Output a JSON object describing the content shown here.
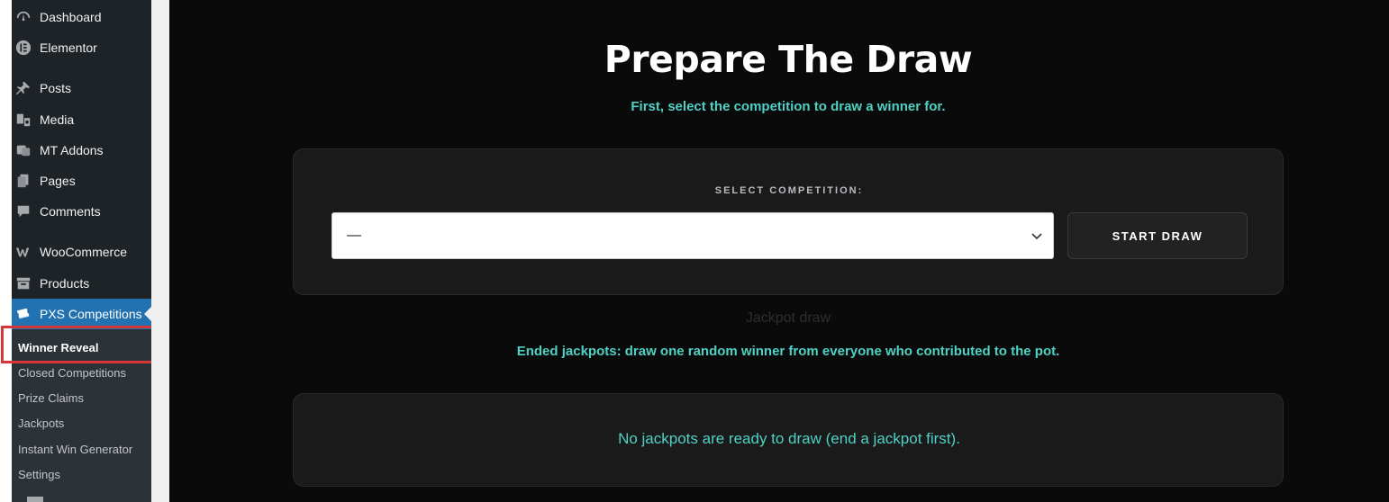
{
  "sidebar": {
    "items": [
      {
        "label": "Dashboard",
        "icon": "dashboard-icon"
      },
      {
        "label": "Elementor",
        "icon": "elementor-icon"
      },
      {
        "label": "Posts",
        "icon": "pin-icon"
      },
      {
        "label": "Media",
        "icon": "media-icon"
      },
      {
        "label": "MT Addons",
        "icon": "addons-icon"
      },
      {
        "label": "Pages",
        "icon": "pages-icon"
      },
      {
        "label": "Comments",
        "icon": "comment-icon"
      },
      {
        "label": "WooCommerce",
        "icon": "woocommerce-icon"
      },
      {
        "label": "Products",
        "icon": "archive-icon"
      },
      {
        "label": "PXS Competitions",
        "icon": "tickets-icon"
      }
    ],
    "submenu": [
      {
        "label": "Winner Reveal"
      },
      {
        "label": "Closed Competitions"
      },
      {
        "label": "Prize Claims"
      },
      {
        "label": "Jackpots"
      },
      {
        "label": "Instant Win Generator"
      },
      {
        "label": "Settings"
      }
    ]
  },
  "main": {
    "title": "Prepare The Draw",
    "subtitle": "First, select the competition to draw a winner for.",
    "select_label": "SELECT COMPETITION:",
    "select_value": "—",
    "start_button": "START DRAW",
    "jackpot_heading": "Jackpot draw",
    "jackpot_desc": "Ended jackpots: draw one random winner from everyone who contributed to the pot.",
    "jackpot_message": "No jackpots are ready to draw (end a jackpot first)."
  },
  "colors": {
    "accent": "#4fd1c5",
    "wp_active": "#2271b1",
    "highlight": "#d63638"
  }
}
